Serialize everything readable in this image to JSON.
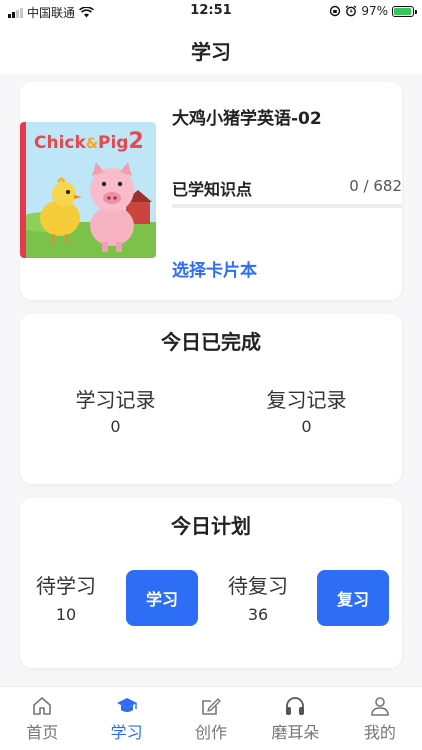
{
  "status_bar": {
    "carrier": "中国联通",
    "time": "12:51",
    "battery_percent": "97%",
    "battery_level": 0.97
  },
  "header": {
    "title": "学习"
  },
  "book": {
    "cover_title_line1": "Chick",
    "cover_title_amp": "&",
    "cover_title_line2": "Pig",
    "cover_number": "2",
    "title": "大鸡小猪学英语-02",
    "learned_label": "已学知识点",
    "learned_count": "0 / 682",
    "progress_fraction": 0,
    "choose_link": "选择卡片本"
  },
  "completed": {
    "title": "今日已完成",
    "study_label": "学习记录",
    "study_value": "0",
    "review_label": "复习记录",
    "review_value": "0"
  },
  "plan": {
    "title": "今日计划",
    "to_study_label": "待学习",
    "to_study_value": "10",
    "study_button": "学习",
    "to_review_label": "待复习",
    "to_review_value": "36",
    "review_button": "复习"
  },
  "tabs": [
    {
      "label": "首页",
      "icon": "home-icon"
    },
    {
      "label": "学习",
      "icon": "graduation-cap-icon",
      "active": true
    },
    {
      "label": "创作",
      "icon": "edit-icon"
    },
    {
      "label": "磨耳朵",
      "icon": "headphones-icon"
    },
    {
      "label": "我的",
      "icon": "user-icon"
    }
  ],
  "colors": {
    "accent": "#2e6df6",
    "background": "#f7f7f9",
    "battery": "#34c759"
  }
}
